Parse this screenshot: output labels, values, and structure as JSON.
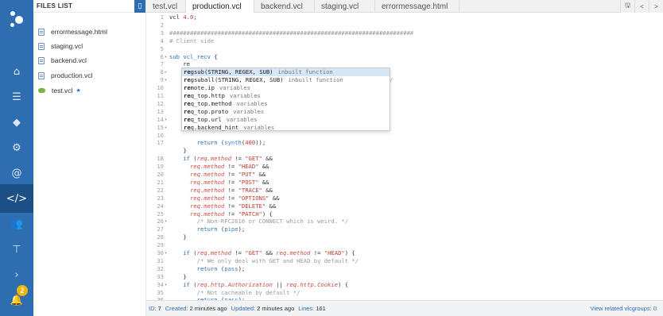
{
  "files_panel": {
    "title": "FILES LIST",
    "items": [
      {
        "label": "errormessage.html",
        "icon": "file-icon"
      },
      {
        "label": "staging.vcl",
        "icon": "file-icon"
      },
      {
        "label": "backend.vcl",
        "icon": "file-icon"
      },
      {
        "label": "production.vcl",
        "icon": "file-icon"
      },
      {
        "label": "test.vcl",
        "icon": "cloud-icon",
        "starred": "★"
      }
    ]
  },
  "tabs": [
    {
      "label": "test.vcl"
    },
    {
      "label": "production.vcl",
      "active": true
    },
    {
      "label": "backend.vcl"
    },
    {
      "label": "staging.vcl"
    },
    {
      "label": "errormessage.html"
    }
  ],
  "tab_tools": {
    "save": "🖫",
    "prev": "<",
    "next": ">"
  },
  "notifications": {
    "count": "2"
  },
  "editor": {
    "lines": [
      {
        "n": "1",
        "fold": "",
        "html": "<span class='c-pl'>vcl </span><span class='c-num'>4.0</span><span class='c-pl'>;</span>"
      },
      {
        "n": "2",
        "fold": "",
        "html": ""
      },
      {
        "n": "3",
        "fold": "",
        "html": "<span class='c-com'>#######################################################################</span>"
      },
      {
        "n": "4",
        "fold": "",
        "html": "<span class='c-com'># Client side</span>"
      },
      {
        "n": "5",
        "fold": "",
        "html": ""
      },
      {
        "n": "6",
        "fold": "▾",
        "html": "<span class='c-kw'>sub</span> <span class='c-def'>vcl_recv</span> <span class='c-pl'>{</span>"
      },
      {
        "n": "7",
        "fold": "",
        "html": "    <span class='c-pl'>re</span>"
      },
      {
        "n": "8",
        "fold": "▸",
        "html": ""
      },
      {
        "n": "9",
        "fold": "▾",
        "html": "                                                      <span class='c-com'>RFC7540) */</span>"
      },
      {
        "n": "10",
        "fold": "",
        "html": ""
      },
      {
        "n": "11",
        "fold": "",
        "html": ""
      },
      {
        "n": "12",
        "fold": "",
        "html": ""
      },
      {
        "n": "13",
        "fold": "",
        "html": ""
      },
      {
        "n": "14",
        "fold": "▾",
        "html": ""
      },
      {
        "n": "15",
        "fold": "▾",
        "html": ""
      },
      {
        "n": "16",
        "fold": "",
        "html": ""
      },
      {
        "n": "17",
        "fold": "",
        "html": "        <span class='c-kw'>return</span> <span class='c-pl'>(</span><span class='c-fn'>synth</span><span class='c-pl'>(</span><span class='c-num'>400</span><span class='c-pl'>));</span>"
      },
      {
        "n": "",
        "fold": "",
        "html": "    <span class='c-pl'>}</span>"
      },
      {
        "n": "18",
        "fold": "",
        "html": "    <span class='c-kw'>if</span> <span class='c-pl'>(</span><span class='c-var'>req.method</span> <span class='c-pl'>!=</span> <span class='c-str'>\"GET\"</span> <span class='c-pl'>&amp;&amp;</span>"
      },
      {
        "n": "19",
        "fold": "",
        "html": "      <span class='c-var'>req.method</span> <span class='c-pl'>!=</span> <span class='c-str'>\"HEAD\"</span> <span class='c-pl'>&amp;&amp;</span>"
      },
      {
        "n": "20",
        "fold": "",
        "html": "      <span class='c-var'>req.method</span> <span class='c-pl'>!=</span> <span class='c-str'>\"PUT\"</span> <span class='c-pl'>&amp;&amp;</span>"
      },
      {
        "n": "21",
        "fold": "",
        "html": "      <span class='c-var'>req.method</span> <span class='c-pl'>!=</span> <span class='c-str'>\"POST\"</span> <span class='c-pl'>&amp;&amp;</span>"
      },
      {
        "n": "22",
        "fold": "",
        "html": "      <span class='c-var'>req.method</span> <span class='c-pl'>!=</span> <span class='c-str'>\"TRACE\"</span> <span class='c-pl'>&amp;&amp;</span>"
      },
      {
        "n": "23",
        "fold": "",
        "html": "      <span class='c-var'>req.method</span> <span class='c-pl'>!=</span> <span class='c-str'>\"OPTIONS\"</span> <span class='c-pl'>&amp;&amp;</span>"
      },
      {
        "n": "24",
        "fold": "",
        "html": "      <span class='c-var'>req.method</span> <span class='c-pl'>!=</span> <span class='c-str'>\"DELETE\"</span> <span class='c-pl'>&amp;&amp;</span>"
      },
      {
        "n": "25",
        "fold": "",
        "html": "      <span class='c-var'>req.method</span> <span class='c-pl'>!=</span> <span class='c-str'>\"PATCH\"</span><span class='c-pl'>) {</span>"
      },
      {
        "n": "26",
        "fold": "▾",
        "html": "        <span class='c-com'>/* Non-RFC2616 or CONNECT which is weird. */</span>"
      },
      {
        "n": "27",
        "fold": "",
        "html": "        <span class='c-kw'>return</span> <span class='c-pl'>(</span><span class='c-fn'>pipe</span><span class='c-pl'>);</span>"
      },
      {
        "n": "28",
        "fold": "",
        "html": "    <span class='c-pl'>}</span>"
      },
      {
        "n": "29",
        "fold": "",
        "html": ""
      },
      {
        "n": "30",
        "fold": "▾",
        "html": "    <span class='c-kw'>if</span> <span class='c-pl'>(</span><span class='c-var'>req.method</span> <span class='c-pl'>!=</span> <span class='c-str'>\"GET\"</span> <span class='c-pl'>&amp;&amp;</span> <span class='c-var'>req.method</span> <span class='c-pl'>!=</span> <span class='c-str'>\"HEAD\"</span><span class='c-pl'>) {</span>"
      },
      {
        "n": "31",
        "fold": "",
        "html": "        <span class='c-com'>/* We only deal with GET and HEAD by default */</span>"
      },
      {
        "n": "32",
        "fold": "",
        "html": "        <span class='c-kw'>return</span> <span class='c-pl'>(</span><span class='c-fn'>pass</span><span class='c-pl'>);</span>"
      },
      {
        "n": "33",
        "fold": "",
        "html": "    <span class='c-pl'>}</span>"
      },
      {
        "n": "34",
        "fold": "▾",
        "html": "    <span class='c-kw'>if</span> <span class='c-pl'>(</span><span class='c-var'>req.http.Authorization</span> <span class='c-pl'>||</span> <span class='c-var'>req.http.Cookie</span><span class='c-pl'>) {</span>"
      },
      {
        "n": "35",
        "fold": "",
        "html": "        <span class='c-com'>/* Not cacheable by default */</span>"
      },
      {
        "n": "36",
        "fold": "",
        "html": "        <span class='c-kw'>return</span> <span class='c-pl'>(</span><span class='c-fn'>pass</span><span class='c-pl'>);</span>"
      }
    ]
  },
  "autocomplete": [
    {
      "match": "re",
      "rest": "gsub(STRING, REGEX, SUB)",
      "type": "inbuilt function",
      "selected": true
    },
    {
      "match": "re",
      "rest": "gsuball(STRING, REGEX, SUB)",
      "type": "inbuilt function"
    },
    {
      "match": "re",
      "rest": "mote.ip",
      "type": "variables"
    },
    {
      "match": "re",
      "rest": "q_top.http",
      "type": "variables"
    },
    {
      "match": "re",
      "rest": "q_top.method",
      "type": "variables"
    },
    {
      "match": "re",
      "rest": "q_top.proto",
      "type": "variables"
    },
    {
      "match": "re",
      "rest": "q_top.url",
      "type": "variables"
    },
    {
      "match": "re",
      "rest": "q.backend_hint",
      "type": "variables"
    }
  ],
  "status": {
    "id_label": "ID:",
    "id": "7",
    "created_label": "Created:",
    "created": "2 minutes ago",
    "updated_label": "Updated:",
    "updated": "2 minutes ago",
    "lines_label": "Lines:",
    "lines": "161",
    "link": "View related vlcgroups: 0"
  },
  "colors": {
    "accent": "#2d6db0",
    "rail": "#2d6db0",
    "rail_active": "#1d4f87",
    "badge": "#f4b400"
  }
}
